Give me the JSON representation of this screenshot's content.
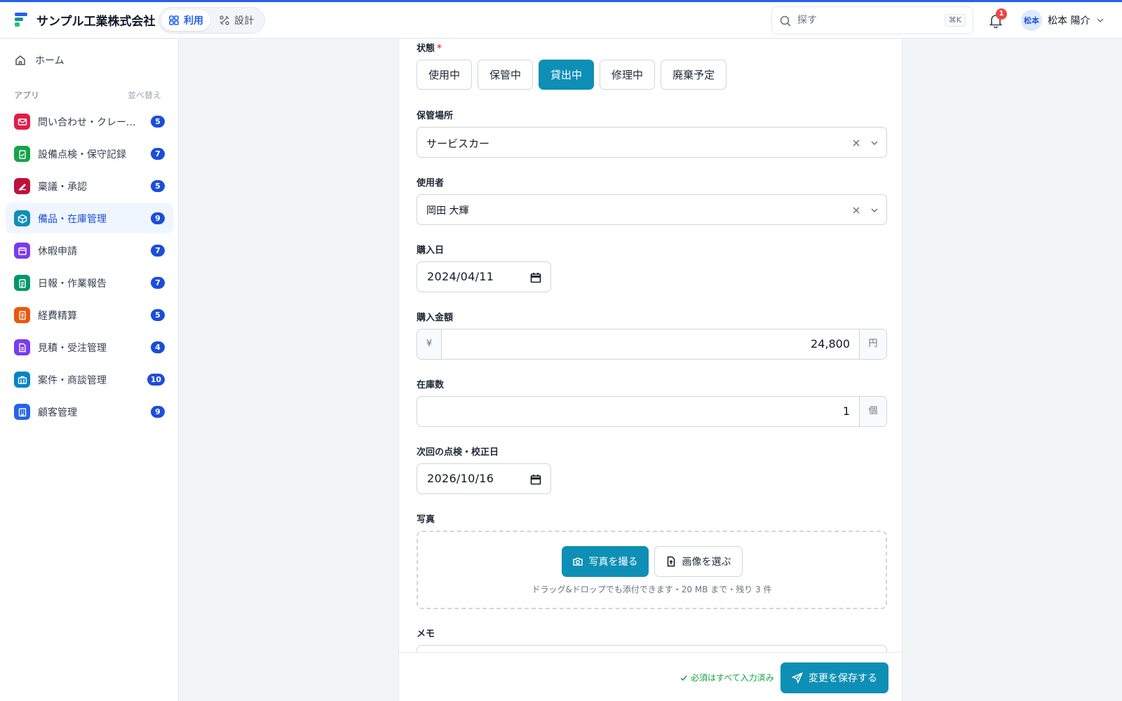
{
  "header": {
    "company": "サンプル工業株式会社",
    "modes": [
      {
        "label": "利用",
        "icon": "grid-icon",
        "active": true
      },
      {
        "label": "設計",
        "icon": "tools-icon",
        "active": false
      }
    ],
    "search": {
      "placeholder": "探す",
      "shortcut": "⌘K"
    },
    "notifications": {
      "count": "1"
    },
    "user": {
      "initials": "松本",
      "name": "松本 陽介"
    }
  },
  "sidebar": {
    "home": "ホーム",
    "apps_label": "アプリ",
    "sort_label": "並べ替え",
    "items": [
      {
        "label": "問い合わせ・クレーム管理",
        "count": "5",
        "color": "#e11d48",
        "icon": "mail-icon"
      },
      {
        "label": "設備点検・保守記録",
        "count": "7",
        "color": "#16a34a",
        "icon": "clipboard-check-icon"
      },
      {
        "label": "稟議・承認",
        "count": "5",
        "color": "#be123c",
        "icon": "signature-icon"
      },
      {
        "label": "備品・在庫管理",
        "count": "9",
        "color": "#0e8fb5",
        "icon": "box-icon",
        "active": true
      },
      {
        "label": "休暇申請",
        "count": "7",
        "color": "#7c3aed",
        "icon": "calendar-icon"
      },
      {
        "label": "日報・作業報告",
        "count": "7",
        "color": "#059669",
        "icon": "clipboard-list-icon"
      },
      {
        "label": "経費精算",
        "count": "5",
        "color": "#ea580c",
        "icon": "receipt-icon"
      },
      {
        "label": "見積・受注管理",
        "count": "4",
        "color": "#7c3aed",
        "icon": "document-icon"
      },
      {
        "label": "案件・商談管理",
        "count": "10",
        "color": "#0284c7",
        "icon": "briefcase-icon"
      },
      {
        "label": "顧客管理",
        "count": "9",
        "color": "#2563eb",
        "icon": "building-icon"
      }
    ]
  },
  "form": {
    "status": {
      "label": "状態",
      "required_mark": "*",
      "options": [
        "使用中",
        "保管中",
        "貸出中",
        "修理中",
        "廃棄予定"
      ],
      "selected": "貸出中"
    },
    "location": {
      "label": "保管場所",
      "value": "サービスカー"
    },
    "user": {
      "label": "使用者",
      "value": "岡田 大輝"
    },
    "purchase_date": {
      "label": "購入日",
      "value": "2024/04/11"
    },
    "price": {
      "label": "購入金額",
      "prefix": "¥",
      "value": "24,800",
      "suffix": "円"
    },
    "stock": {
      "label": "在庫数",
      "value": "1",
      "suffix": "個"
    },
    "next_check": {
      "label": "次回の点検・校正日",
      "value": "2026/10/16"
    },
    "photo": {
      "label": "写真",
      "take_button": "写真を撮る",
      "choose_button": "画像を選ぶ",
      "hint": "ドラッグ&ドロップでも添付できます・20 MB まで・残り 3 件"
    },
    "memo": {
      "label": "メモ"
    }
  },
  "footer": {
    "status": "必須はすべて入力済み",
    "save_button": "変更を保存する"
  },
  "colors": {
    "accent": "#0e8fb5",
    "brand": "#2563eb",
    "badge": "#1d4ed8"
  }
}
